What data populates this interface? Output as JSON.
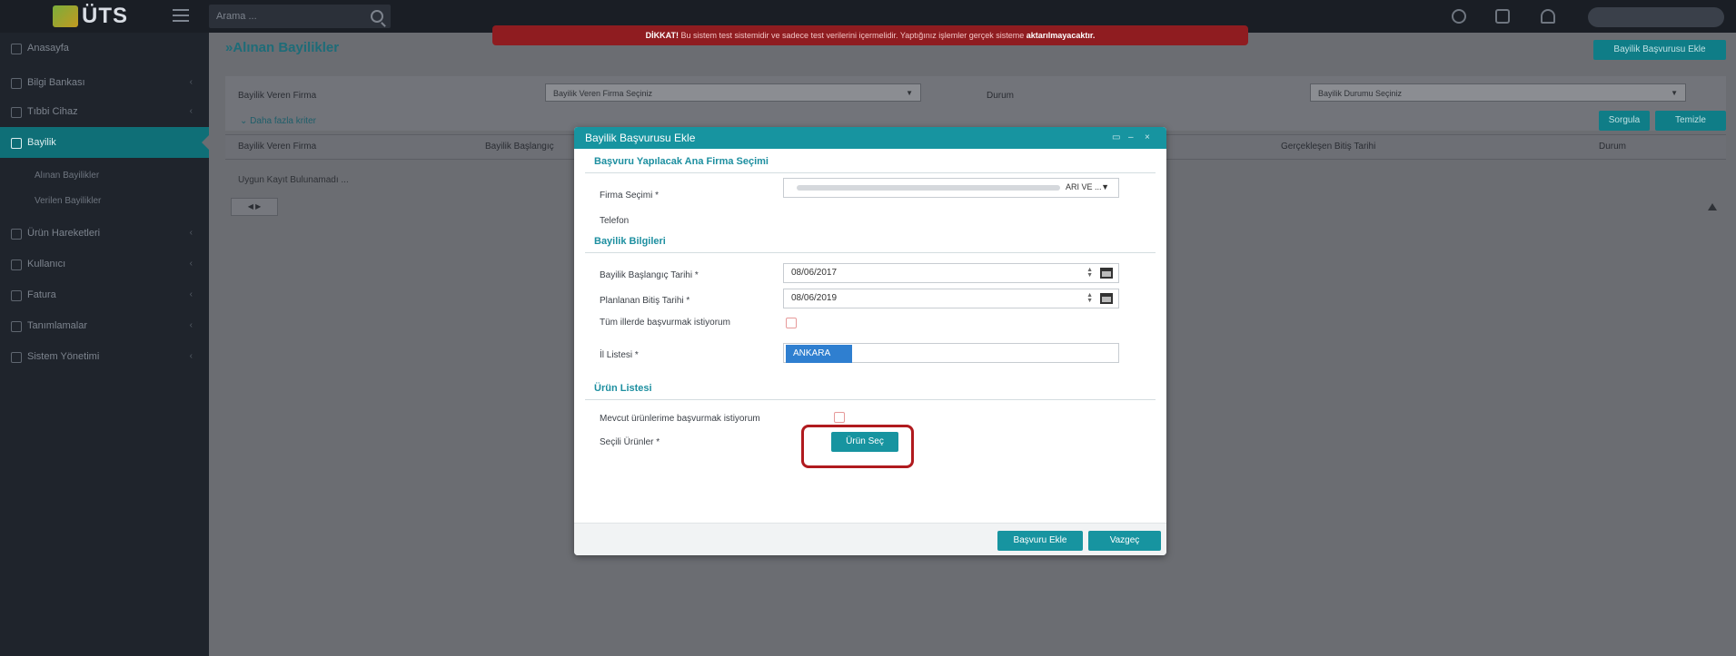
{
  "topbar": {
    "logo_text": "ÜTS",
    "search_placeholder": "Arama ..."
  },
  "warning": {
    "prefix": "DİKKAT!",
    "text": " Bu sistem test sistemidir ve sadece test verilerini içermelidir. Yaptığınız işlemler gerçek sisteme ",
    "suffix": "aktarılmayacaktır."
  },
  "sidebar": {
    "items": [
      {
        "label": "Anasayfa",
        "icon": "home-icon"
      },
      {
        "label": "Bilgi Bankası",
        "icon": "info-icon"
      },
      {
        "label": "Tıbbi Cihaz",
        "icon": "device-icon"
      },
      {
        "label": "Bayilik",
        "icon": "key-icon"
      },
      {
        "label": "Ürün Hareketleri",
        "icon": "exchange-icon"
      },
      {
        "label": "Kullanıcı",
        "icon": "user-icon"
      },
      {
        "label": "Fatura",
        "icon": "invoice-icon"
      },
      {
        "label": "Tanımlamalar",
        "icon": "tag-icon"
      },
      {
        "label": "Sistem Yönetimi",
        "icon": "wrench-icon"
      }
    ],
    "sub_items": [
      "Alınan Bayilikler",
      "Verilen Bayilikler"
    ]
  },
  "main": {
    "title": "»Alınan Bayilikler",
    "add_button": "Bayilik Başvurusu Ekle",
    "filters": {
      "firma_label": "Bayilik Veren Firma",
      "firma_placeholder": "Bayilik Veren Firma Seçiniz",
      "durum_label": "Durum",
      "durum_placeholder": "Bayilik Durumu Seçiniz"
    },
    "more_link": "Daha fazla kriter",
    "search_button": "Sorgula",
    "clear_button": "Temizle",
    "columns": [
      "Bayilik Veren Firma",
      "Bayilik Başlangıç",
      "Gerçekleşen Bitiş Tarihi",
      "Durum"
    ],
    "empty_text": "Uygun Kayıt Bulunamadı ..."
  },
  "dialog": {
    "title": "Bayilik Başvurusu Ekle",
    "section1": "Başvuru Yapılacak Ana Firma Seçimi",
    "firma_label": "Firma Seçimi *",
    "firma_value_tail": "ARI VE ...",
    "telefon_label": "Telefon",
    "section2": "Bayilik Bilgileri",
    "start_label": "Bayilik Başlangıç Tarihi *",
    "start_value": "08/06/2017",
    "end_label": "Planlanan Bitiş Tarihi *",
    "end_value": "08/06/2019",
    "all_cities_label": "Tüm illerde başvurmak istiyorum",
    "city_label": "İl Listesi *",
    "city_tag": "ANKARA",
    "section3": "Ürün Listesi",
    "existing_products_label": "Mevcut ürünlerime başvurmak istiyorum",
    "selected_products_label": "Seçili Ürünler *",
    "select_product_button": "Ürün Seç",
    "submit_button": "Başvuru Ekle",
    "cancel_button": "Vazgeç"
  },
  "colors": {
    "accent": "#1794a0",
    "warning": "#8f1c20",
    "highlight": "#b01a1e"
  }
}
